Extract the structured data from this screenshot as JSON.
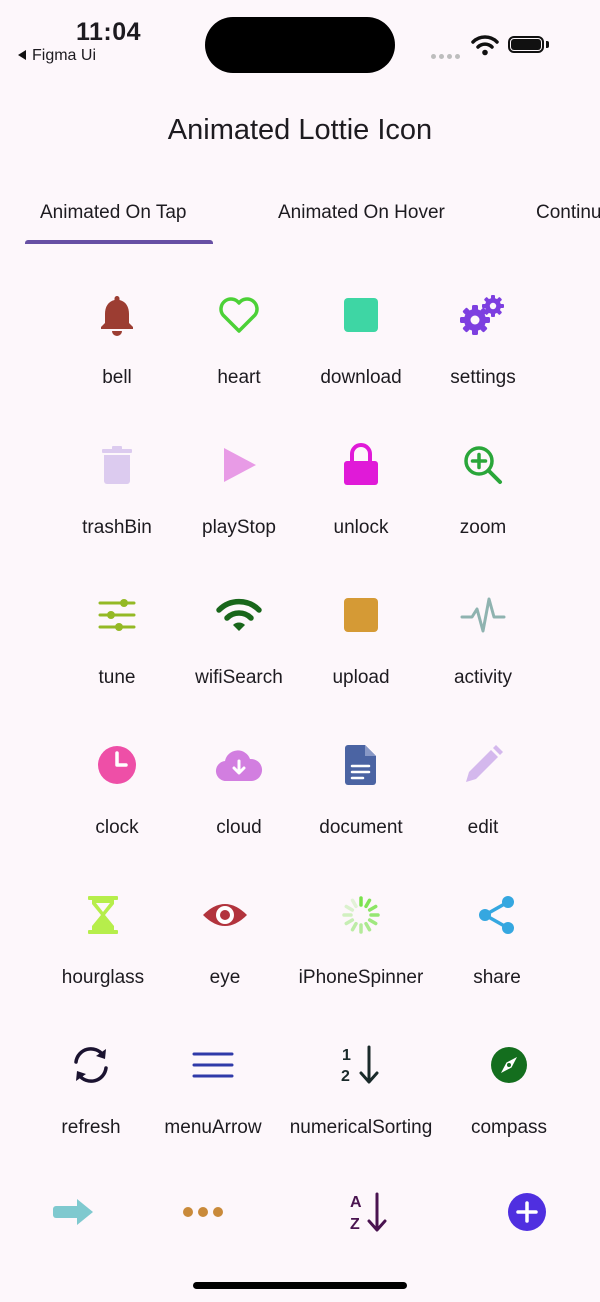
{
  "status": {
    "time": "11:04",
    "back_app": "Figma Ui"
  },
  "app_bar": {
    "title": "Animated Lottie Icon"
  },
  "tabs": [
    {
      "label": "Animated On Tap"
    },
    {
      "label": "Animated On Hover"
    },
    {
      "label": "Continu"
    }
  ],
  "icons": [
    {
      "label": "bell",
      "icon": "bell-icon",
      "color": "#9c3d32"
    },
    {
      "label": "heart",
      "icon": "heart-icon",
      "color": "#4cd137"
    },
    {
      "label": "download",
      "icon": "download-icon",
      "color": "#3ed6a4"
    },
    {
      "label": "settings",
      "icon": "settings-icon",
      "color": "#7d3fe0"
    },
    {
      "label": "trashBin",
      "icon": "trash-icon",
      "color": "#dccbef"
    },
    {
      "label": "playStop",
      "icon": "play-icon",
      "color": "#e89be6"
    },
    {
      "label": "unlock",
      "icon": "lock-icon",
      "color": "#e01ad8"
    },
    {
      "label": "zoom",
      "icon": "zoom-icon",
      "color": "#2aa63a"
    },
    {
      "label": "tune",
      "icon": "tune-icon",
      "color": "#94b925"
    },
    {
      "label": "wifiSearch",
      "icon": "wifi-icon",
      "color": "#19661b"
    },
    {
      "label": "upload",
      "icon": "upload-icon",
      "color": "#d59a35"
    },
    {
      "label": "activity",
      "icon": "activity-icon",
      "color": "#8fb3b0"
    },
    {
      "label": "clock",
      "icon": "clock-icon",
      "color": "#ee4fa7"
    },
    {
      "label": "cloud",
      "icon": "cloud-icon",
      "color": "#d27ee0"
    },
    {
      "label": "document",
      "icon": "document-icon",
      "color": "#4b64a3"
    },
    {
      "label": "edit",
      "icon": "pencil-icon",
      "color": "#d4b8ed"
    },
    {
      "label": "hourglass",
      "icon": "hourglass-icon",
      "color": "#b6ee4b"
    },
    {
      "label": "eye",
      "icon": "eye-icon",
      "color": "#b2343d"
    },
    {
      "label": "iPhoneSpinner",
      "icon": "spinner-icon",
      "color": "#79e24c"
    },
    {
      "label": "share",
      "icon": "share-icon",
      "color": "#35a7e0"
    },
    {
      "label": "refresh",
      "icon": "refresh-icon",
      "color": "#1b1330"
    },
    {
      "label": "menuArrow",
      "icon": "menu-icon",
      "color": "#2f3aa9"
    },
    {
      "label": "numericalSorting",
      "icon": "number-sort-icon",
      "color": "#1a2a2a"
    },
    {
      "label": "compass",
      "icon": "compass-icon",
      "color": "#146e1e"
    }
  ],
  "bottom_icons": [
    {
      "icon": "arrow-right-icon",
      "color": "#7fc9cf"
    },
    {
      "icon": "more-dots-icon",
      "color": "#c98a3a"
    },
    {
      "icon": "alpha-sort-icon",
      "color": "#4a1450",
      "text_a": "A",
      "text_z": "Z"
    },
    {
      "icon": "add-circle-icon",
      "color": "#4f2fe0"
    }
  ]
}
